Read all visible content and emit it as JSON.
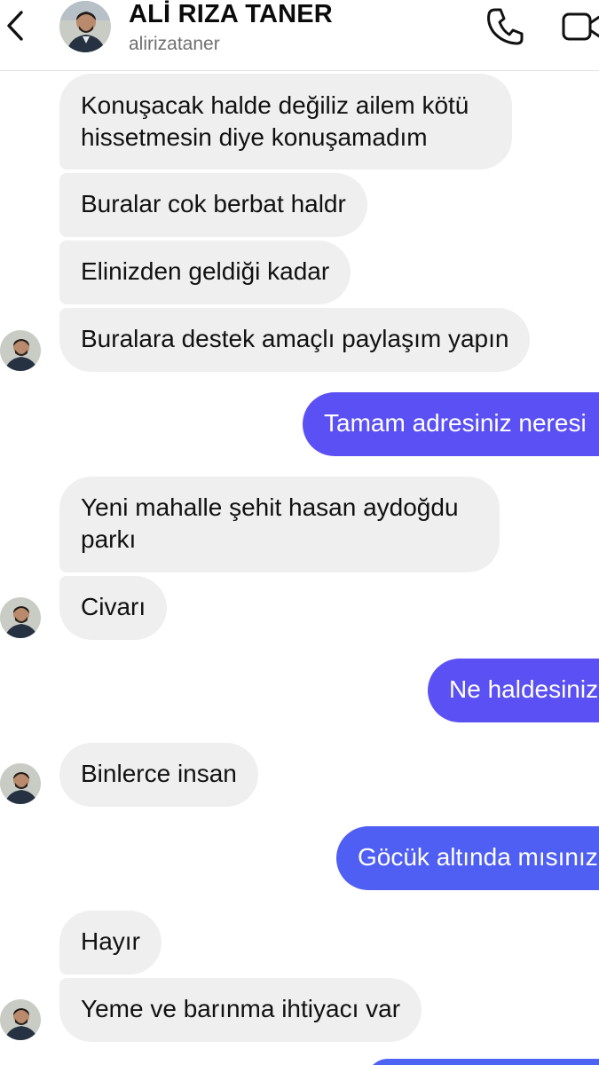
{
  "header": {
    "title": "ALİ RIZA TANER",
    "username": "alirizataner",
    "back_icon": "chevron-left-icon",
    "call_icon": "phone-icon",
    "video_icon": "video-camera-icon"
  },
  "messages": [
    {
      "direction": "incoming",
      "text": "Konuşacak halde değiliz ailem kötü\nhissetmesin diye konuşamadım"
    },
    {
      "direction": "incoming",
      "text": "Buralar cok berbat haldr"
    },
    {
      "direction": "incoming",
      "text": "Elinizden geldiği kadar"
    },
    {
      "direction": "incoming",
      "text": "Buralara destek amaçlı paylaşım yapın"
    },
    {
      "direction": "outgoing",
      "text": "Tamam  adresiniz neresi"
    },
    {
      "direction": "incoming",
      "text": "Yeni mahalle şehit hasan aydoğdu\nparkı"
    },
    {
      "direction": "incoming",
      "text": "Civarı"
    },
    {
      "direction": "outgoing",
      "text": "Ne haldesiniz"
    },
    {
      "direction": "incoming",
      "text": "Binlerce insan"
    },
    {
      "direction": "outgoing",
      "text": "Göcük altında mısınız"
    },
    {
      "direction": "incoming",
      "text": "Hayır"
    },
    {
      "direction": "incoming",
      "text": "Yeme ve barınma ihtiyacı var"
    }
  ],
  "colors": {
    "incoming_bubble": "#efefef",
    "outgoing_bubble": "#5b50f3",
    "outgoing_bubble_bottom": "#4d63f3"
  }
}
